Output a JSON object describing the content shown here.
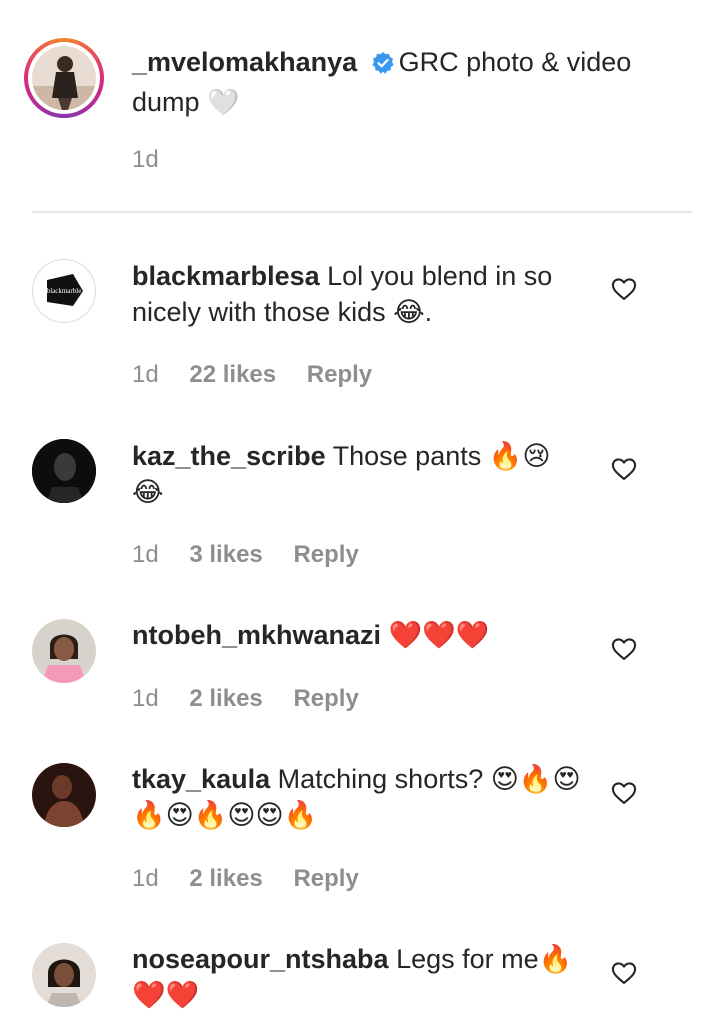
{
  "caption": {
    "username": "_mvelomakhanya",
    "text": "GRC photo & video dump",
    "emoji": "🤍",
    "time": "1d"
  },
  "comments": [
    {
      "username": "blackmarblesa",
      "text": "Lol you blend in so nicely with those kids 😂.",
      "time": "1d",
      "likes": "22 likes",
      "reply": "Reply",
      "avatar_text": "blackmarble"
    },
    {
      "username": "kaz_the_scribe",
      "text": "Those pants 🔥😢😂",
      "time": "1d",
      "likes": "3 likes",
      "reply": "Reply"
    },
    {
      "username": "ntobeh_mkhwanazi",
      "text": "❤️❤️❤️",
      "time": "1d",
      "likes": "2 likes",
      "reply": "Reply"
    },
    {
      "username": "tkay_kaula",
      "text": "Matching shorts? 😍🔥😍🔥😍🔥😍😍🔥",
      "time": "1d",
      "likes": "2 likes",
      "reply": "Reply"
    },
    {
      "username": "noseapour_ntshaba",
      "text": "Legs for me🔥❤️❤️"
    }
  ],
  "colors": {
    "text": "#262626",
    "meta": "#8e8e8e",
    "verified": "#3897f0",
    "divider": "#e6e6e6"
  },
  "icons": {
    "verified": "verified-badge-icon",
    "like": "heart-outline-icon"
  }
}
